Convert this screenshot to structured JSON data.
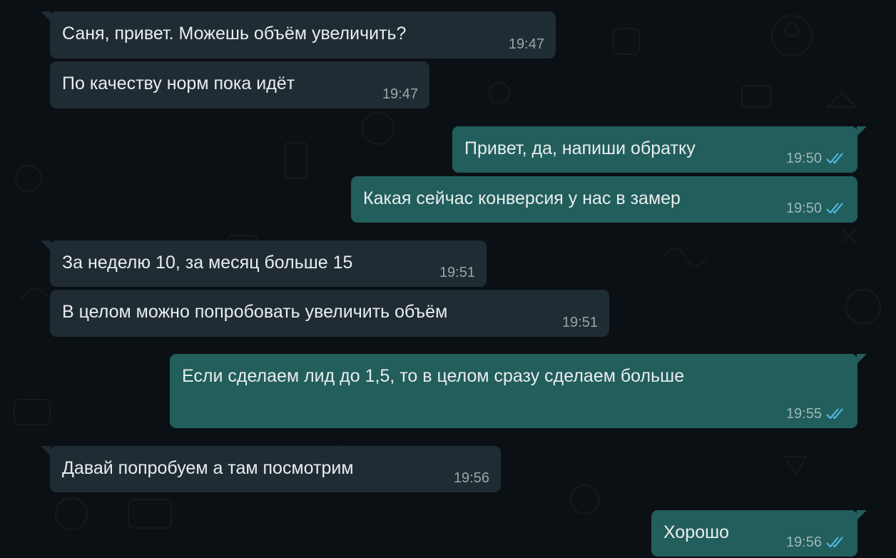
{
  "colors": {
    "background": "#0b1014",
    "incoming_bubble": "#202c33",
    "outgoing_bubble": "#225e5c",
    "read_ticks": "#53bdeb"
  },
  "messages": [
    {
      "direction": "incoming",
      "text": "Саня, привет. Можешь объём увеличить?",
      "time": "19:47"
    },
    {
      "direction": "incoming",
      "text": "По качеству норм пока идёт",
      "time": "19:47"
    },
    {
      "direction": "outgoing",
      "text": "Привет, да, напиши обратку",
      "time": "19:50",
      "status": "read-double-check-icon"
    },
    {
      "direction": "outgoing",
      "text": "Какая сейчас конверсия у нас в замер",
      "time": "19:50",
      "status": "read-double-check-icon"
    },
    {
      "direction": "incoming",
      "text": "За неделю 10, за месяц больше 15",
      "time": "19:51"
    },
    {
      "direction": "incoming",
      "text": "В целом можно попробовать увеличить объём",
      "time": "19:51"
    },
    {
      "direction": "outgoing",
      "text": "Если сделаем лид до 1,5, то в целом сразу сделаем больше",
      "time": "19:55",
      "status": "read-double-check-icon"
    },
    {
      "direction": "incoming",
      "text": "Давай попробуем а там посмотрим",
      "time": "19:56"
    },
    {
      "direction": "outgoing",
      "text": "Хорошо",
      "time": "19:56",
      "status": "read-double-check-icon"
    }
  ]
}
